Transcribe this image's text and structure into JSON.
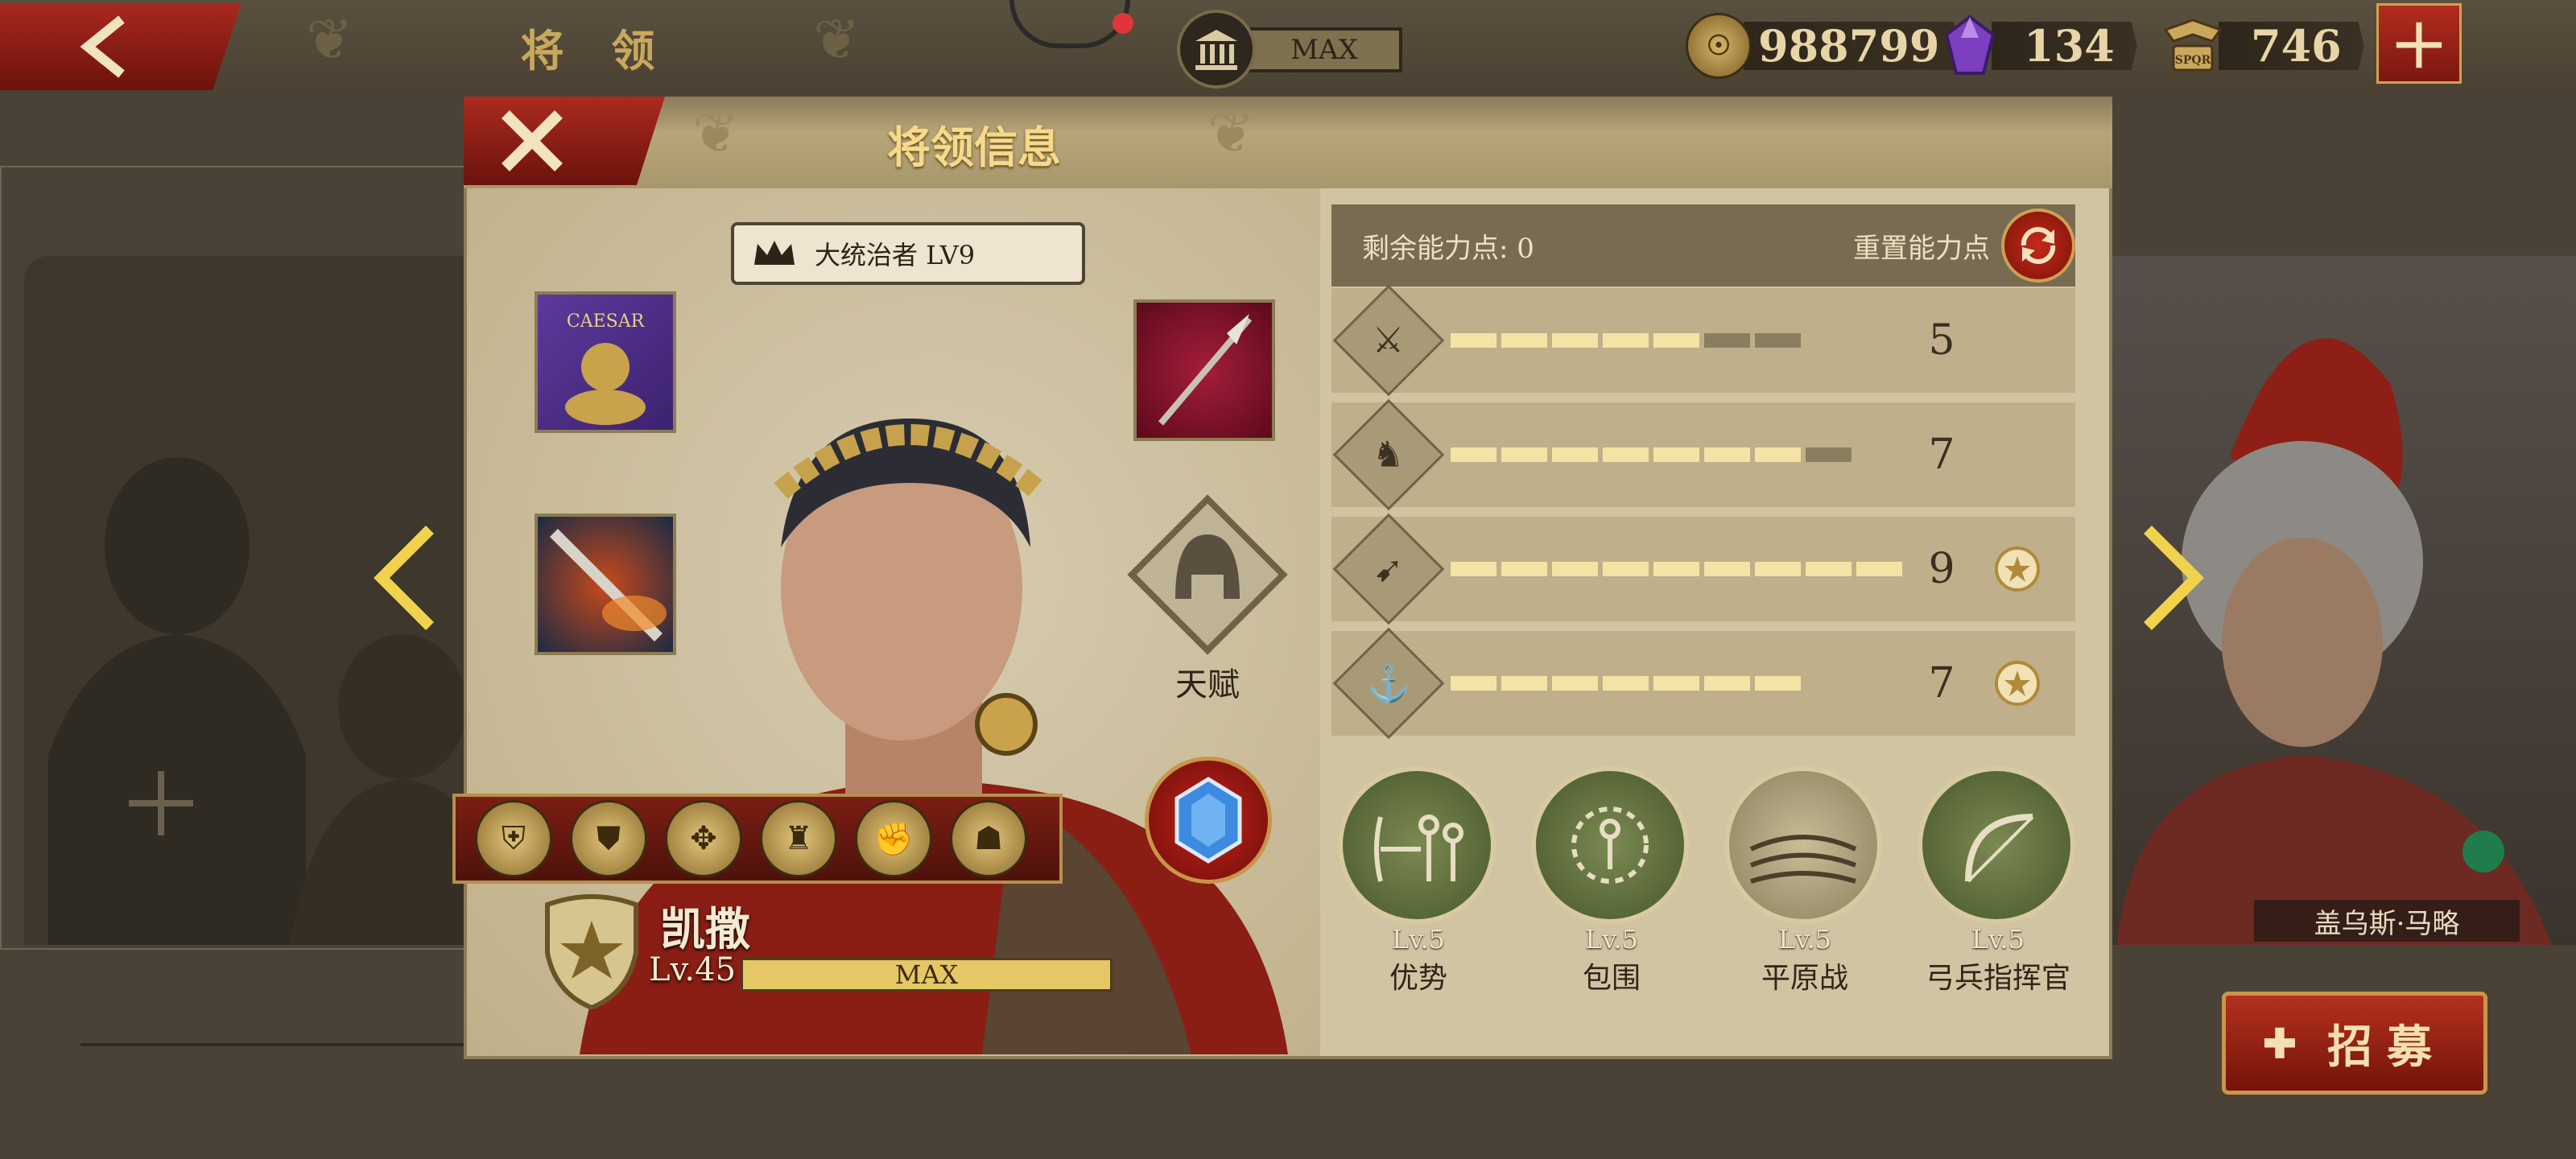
{
  "topbar": {
    "title": "将 领",
    "building_level": "MAX",
    "gold": "988799",
    "gems": "134",
    "honor": "746",
    "add_label": "+"
  },
  "panel": {
    "title": "将领信息",
    "rank": "大统治者 LV9",
    "talent_label": "天赋",
    "general_name": "凯撒",
    "level": "Lv.45",
    "level_bar": "MAX"
  },
  "stats": {
    "points_label": "剩余能力点: 0",
    "reset_label": "重置能力点",
    "rows": [
      {
        "icon": "sword-icon",
        "value": "5",
        "filled": 5,
        "total": 7,
        "badge": false
      },
      {
        "icon": "horse-icon",
        "value": "7",
        "filled": 7,
        "total": 8,
        "badge": false
      },
      {
        "icon": "bow-icon",
        "value": "9",
        "filled": 9,
        "total": 9,
        "badge": true
      },
      {
        "icon": "anchor-icon",
        "value": "7",
        "filled": 7,
        "total": 7,
        "badge": true
      }
    ]
  },
  "abilities": [
    {
      "level": "Lv.5",
      "name": "优势"
    },
    {
      "level": "Lv.5",
      "name": "包围"
    },
    {
      "level": "Lv.5",
      "name": "平原战"
    },
    {
      "level": "Lv.5",
      "name": "弓兵指挥官"
    }
  ],
  "side": {
    "right_general_name": "盖乌斯·马略",
    "recruit_label": "招募"
  },
  "colors": {
    "accent_red": "#a9281d",
    "gold_text": "#f6d98a",
    "panel_bg": "#d1c4a3"
  }
}
